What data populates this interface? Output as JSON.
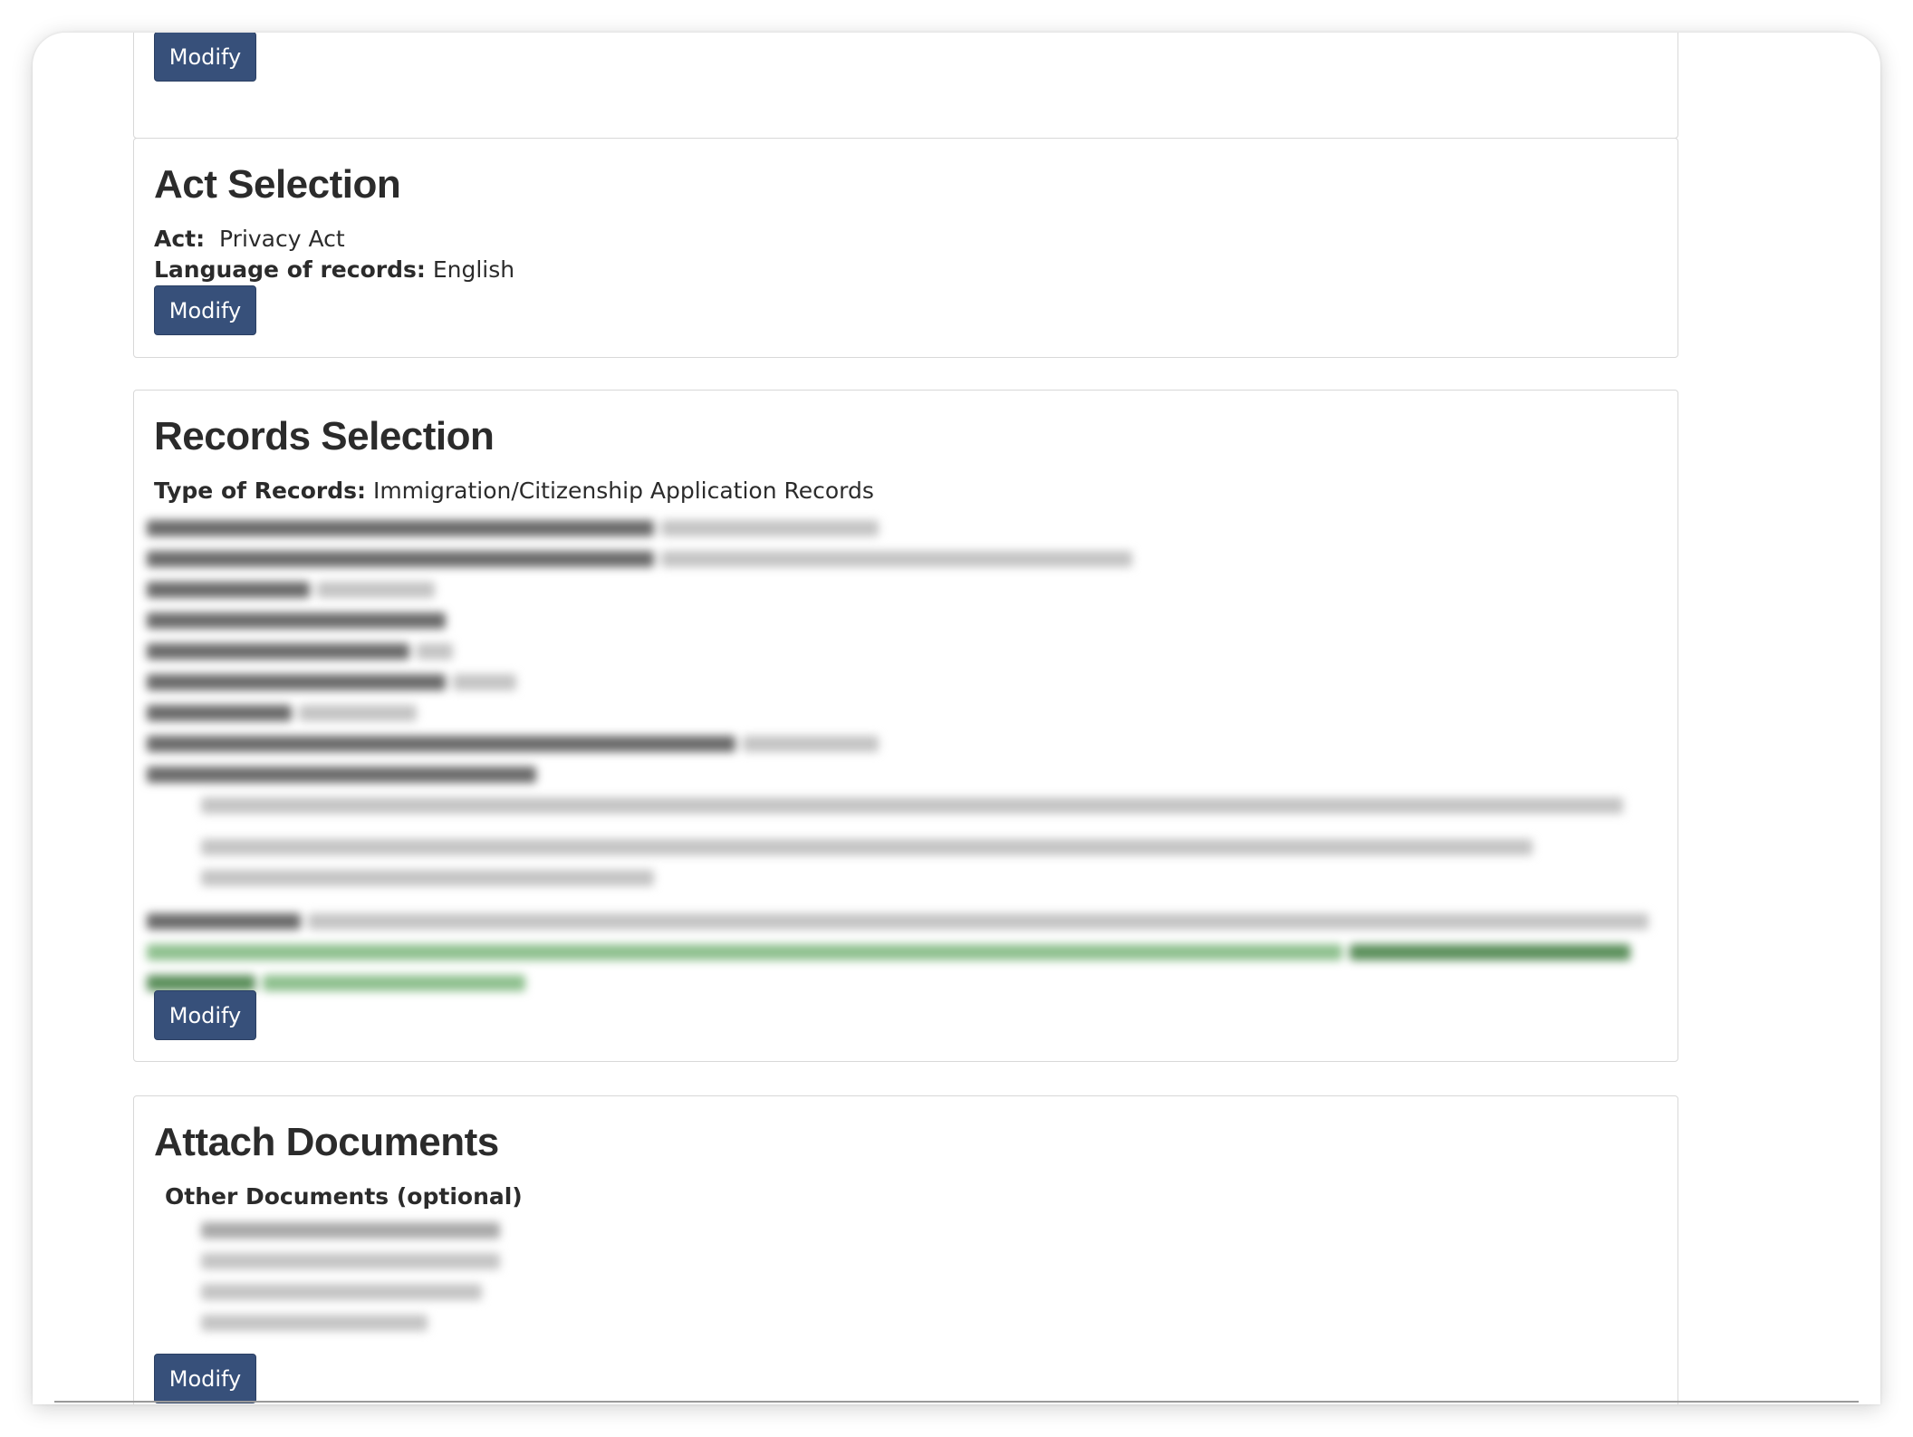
{
  "sections": {
    "top": {
      "modify_label": "Modify"
    },
    "act_selection": {
      "title": "Act Selection",
      "act_label": "Act:",
      "act_value": "Privacy Act",
      "language_label": "Language of records:",
      "language_value": "English",
      "modify_label": "Modify"
    },
    "records_selection": {
      "title": "Records Selection",
      "type_label": "Type of Records:",
      "type_value": "Immigration/Citizenship Application Records",
      "modify_label": "Modify"
    },
    "attach_documents": {
      "title": "Attach Documents",
      "other_docs_label": "Other Documents (optional)",
      "modify_label": "Modify"
    }
  },
  "colors": {
    "button_bg": "#37507a",
    "panel_border": "#d8d8d8"
  }
}
